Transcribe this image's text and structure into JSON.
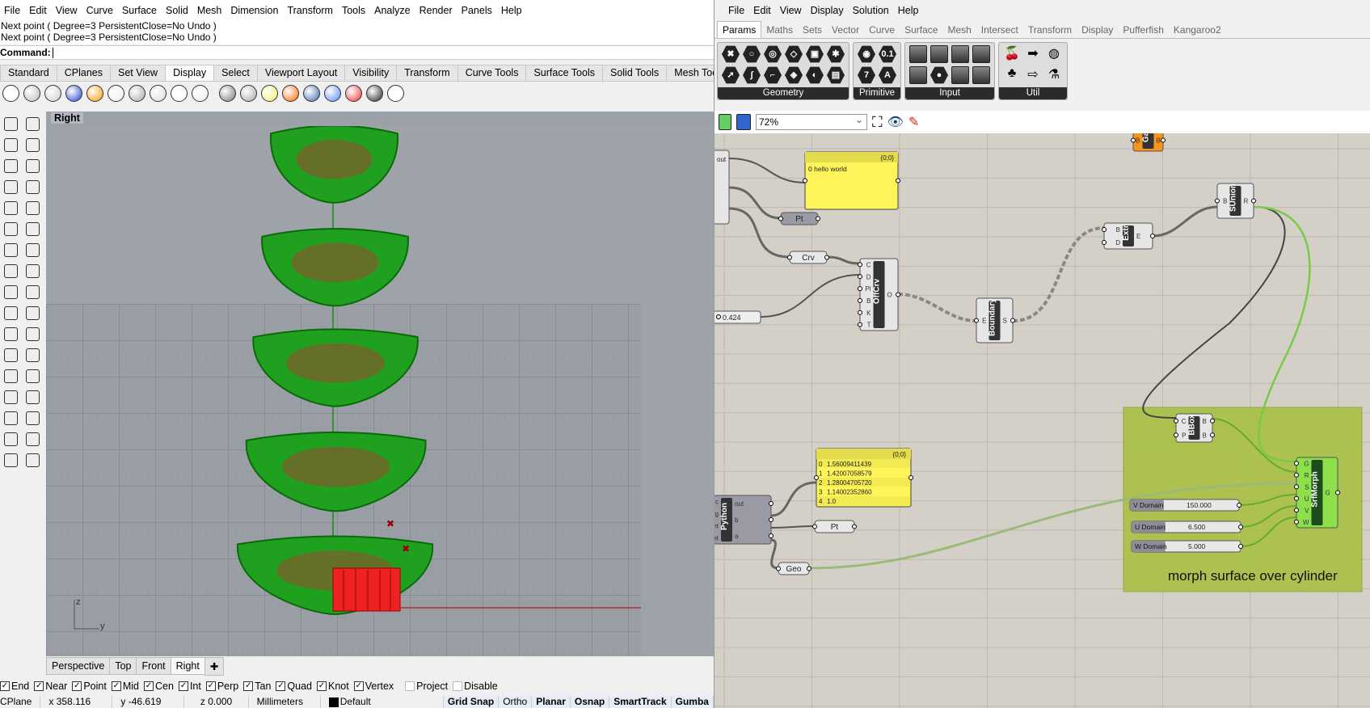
{
  "rhino": {
    "menu": [
      "File",
      "Edit",
      "View",
      "Curve",
      "Surface",
      "Solid",
      "Mesh",
      "Dimension",
      "Transform",
      "Tools",
      "Analyze",
      "Render",
      "Panels",
      "Help"
    ],
    "history": [
      "Next point ( Degree=3  PersistentClose=No  Undo )",
      "Next point ( Degree=3  PersistentClose=No  Undo )"
    ],
    "command_label": "Command:",
    "command_value": "",
    "toolbar_tabs": [
      "Standard",
      "CPlanes",
      "Set View",
      "Display",
      "Select",
      "Viewport Layout",
      "Visibility",
      "Transform",
      "Curve Tools",
      "Surface Tools",
      "Solid Tools",
      "Mesh Tools"
    ],
    "active_toolbar_tab": "Display",
    "viewport_title": "Right",
    "axis_z": "z",
    "axis_y": "y",
    "viewport_tabs": [
      "Perspective",
      "Top",
      "Front",
      "Right",
      "✚"
    ],
    "active_viewport_tab": "Right",
    "osnaps": [
      {
        "label": "End",
        "checked": true
      },
      {
        "label": "Near",
        "checked": true
      },
      {
        "label": "Point",
        "checked": true
      },
      {
        "label": "Mid",
        "checked": true
      },
      {
        "label": "Cen",
        "checked": true
      },
      {
        "label": "Int",
        "checked": true
      },
      {
        "label": "Perp",
        "checked": true
      },
      {
        "label": "Tan",
        "checked": true
      },
      {
        "label": "Quad",
        "checked": true
      },
      {
        "label": "Knot",
        "checked": true
      },
      {
        "label": "Vertex",
        "checked": true
      },
      {
        "label": "Project",
        "checked": false
      },
      {
        "label": "Disable",
        "checked": false
      }
    ],
    "status": {
      "cplane": "CPlane",
      "x": "x 358.116",
      "y": "y -46.619",
      "z": "z 0.000",
      "units": "Millimeters",
      "layer": "Default",
      "toggles": [
        "Grid Snap",
        "Ortho",
        "Planar",
        "Osnap",
        "SmartTrack",
        "Gumba"
      ]
    }
  },
  "gh": {
    "menu": [
      "File",
      "Edit",
      "View",
      "Display",
      "Solution",
      "Help"
    ],
    "tabs": [
      "Params",
      "Maths",
      "Sets",
      "Vector",
      "Curve",
      "Surface",
      "Mesh",
      "Intersect",
      "Transform",
      "Display",
      "Pufferfish",
      "Kangaroo2"
    ],
    "active_tab": "Params",
    "ribbon_groups": [
      "Geometry",
      "Primitive",
      "Input",
      "Util"
    ],
    "zoom": "72%",
    "nodes": {
      "panel1": {
        "header": "{0;0}",
        "lines": [
          "0 hello world"
        ]
      },
      "panel2": {
        "header": "{0;0}",
        "rows": [
          [
            "0",
            "1.56009411439"
          ],
          [
            "1",
            "1.42007058579"
          ],
          [
            "2",
            "1.28004705720"
          ],
          [
            "3",
            "1.14002352860"
          ],
          [
            "4",
            "1.0"
          ]
        ]
      },
      "pt1": "Pt",
      "crv": "Crv",
      "pt2": "Pt",
      "geo": "Geo",
      "offcrv": {
        "name": "OffCrv",
        "inputs": [
          "C",
          "D",
          "Pl",
          "B",
          "K",
          "T"
        ],
        "outputs": [
          "O"
        ]
      },
      "boundary": {
        "name": "Boundary",
        "inputs": [
          "E"
        ],
        "outputs": [
          "S"
        ]
      },
      "extr": {
        "name": "Extr",
        "inputs": [
          "B",
          "D"
        ],
        "outputs": [
          "E"
        ]
      },
      "sunion": {
        "name": "SUnion",
        "inputs": [
          "B"
        ],
        "outputs": [
          "R"
        ]
      },
      "gate": {
        "name": "Ga",
        "inputs": [
          "B"
        ],
        "outputs": [
          "B"
        ]
      },
      "bbox": {
        "name": "BBox",
        "inputs": [
          "C",
          "P"
        ],
        "outputs": [
          "B",
          "B"
        ]
      },
      "srfmorph": {
        "name": "SrfMorph",
        "inputs": [
          "G",
          "R",
          "S",
          "U",
          "V",
          "W"
        ],
        "outputs": [
          "G"
        ]
      },
      "python": {
        "name": "Python",
        "inputs": [
          "c",
          "g",
          "count",
          "ckOffset"
        ],
        "outputs": [
          "out",
          "b",
          "a"
        ]
      },
      "left_node_outputs": [
        "out"
      ],
      "slider1": "0.424",
      "v_domain": {
        "label": "V Domain",
        "value": "150.000"
      },
      "u_domain": {
        "label": "U Domain",
        "value": "6.500"
      },
      "w_domain": {
        "label": "W Domain",
        "value": "5.000"
      },
      "group_label": "morph surface over cylinder"
    }
  }
}
